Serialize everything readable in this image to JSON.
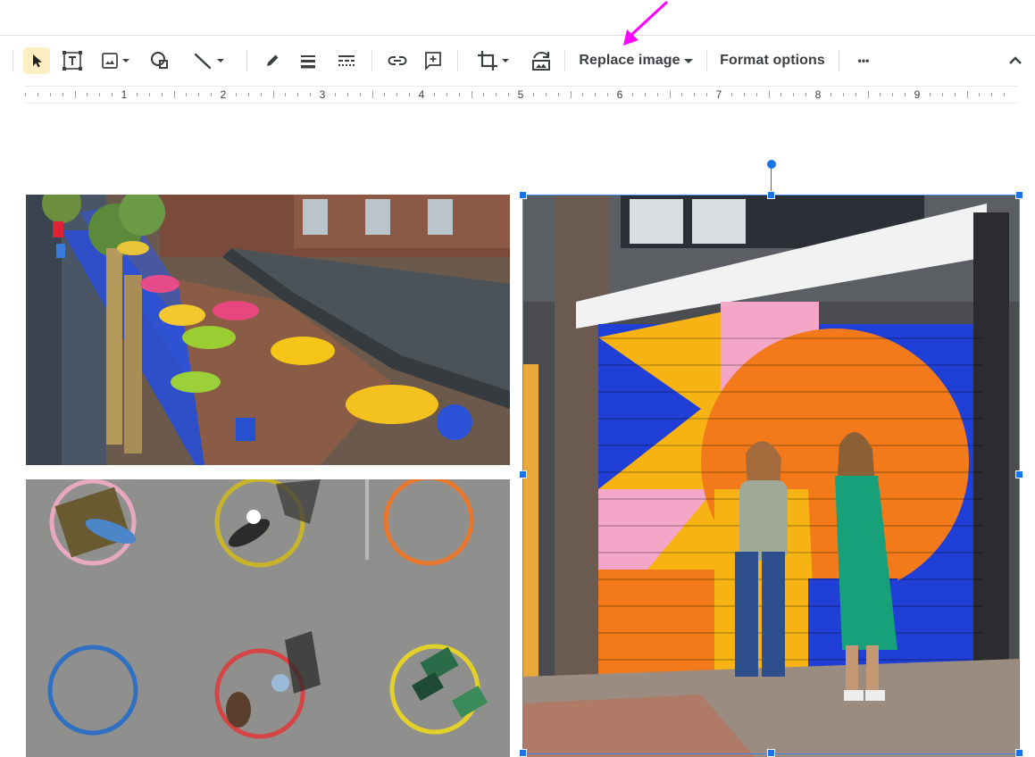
{
  "toolbar": {
    "tools": [
      {
        "name": "select-tool",
        "icon": "cursor-arrow-icon",
        "active": true
      },
      {
        "name": "text-box-tool",
        "icon": "text-box-icon"
      },
      {
        "name": "image-tool",
        "icon": "image-icon"
      },
      {
        "name": "shape-tool",
        "icon": "shape-icon"
      },
      {
        "name": "line-tool",
        "icon": "line-icon"
      },
      {
        "name": "border-color-tool",
        "icon": "pencil-icon"
      },
      {
        "name": "border-weight-tool",
        "icon": "line-weight-icon"
      },
      {
        "name": "border-dash-tool",
        "icon": "line-dash-icon"
      },
      {
        "name": "insert-link-tool",
        "icon": "link-icon"
      },
      {
        "name": "add-comment-tool",
        "icon": "comment-add-icon"
      },
      {
        "name": "crop-tool",
        "icon": "crop-icon"
      },
      {
        "name": "reset-image-tool",
        "icon": "reset-image-icon"
      }
    ],
    "replace_image_label": "Replace image",
    "format_options_label": "Format options",
    "more_label": "•••",
    "collapse_icon": "chevron-up-icon"
  },
  "ruler": {
    "numbers": [
      "1",
      "2",
      "3",
      "4",
      "5",
      "6",
      "7",
      "8",
      "9"
    ]
  },
  "annotation": {
    "arrow_color": "#ff00ff"
  },
  "colors": {
    "selection": "#1a73e8",
    "active_tool_bg": "#feefc3",
    "mural_blue": "#1f3fd6",
    "mural_orange": "#f27a1a",
    "mural_yellow": "#f7b313",
    "dress_green": "#18a07a"
  }
}
